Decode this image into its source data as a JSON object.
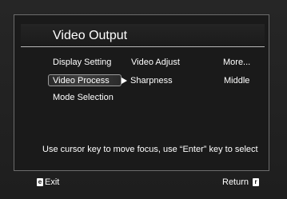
{
  "menu": {
    "title": "Video Output",
    "rows": [
      {
        "label": "Display Setting",
        "sub": "Video Adjust",
        "value": "More..."
      },
      {
        "label": "Video Process",
        "sub": "Sharpness",
        "value": "Middle"
      },
      {
        "label": "Mode Selection"
      }
    ],
    "help_text": "Use cursor key to move focus, use “Enter” key to select"
  },
  "footer": {
    "exit_key": "e",
    "exit_label": "Exit",
    "return_label": "Return",
    "return_key": "r"
  },
  "colors": {
    "background": "#1f1f1f",
    "text": "#ffffff",
    "panel_border": "#6c6c6c",
    "selection_border": "#9a9a9a"
  },
  "icons": {
    "selection_arrow": "right-triangle-icon",
    "exit_key_icon": "exit-key-icon",
    "return_key_icon": "return-key-icon"
  }
}
